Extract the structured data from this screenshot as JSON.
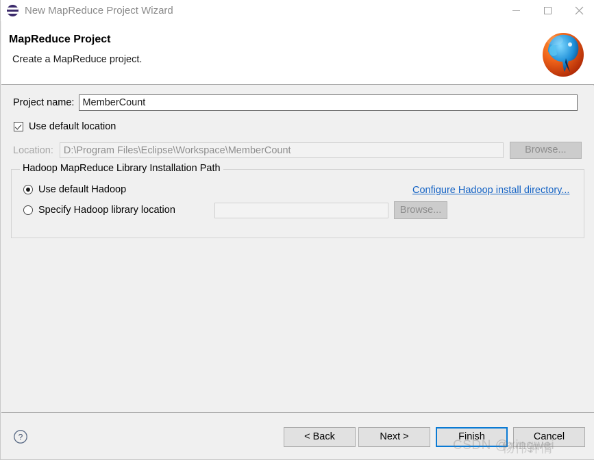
{
  "window": {
    "title": "New MapReduce Project Wizard",
    "icon": "eclipse-wizard-icon",
    "controls": {
      "minimize": "minimize-icon",
      "maximize": "maximize-icon",
      "close": "close-icon"
    }
  },
  "header": {
    "title": "MapReduce Project",
    "subtitle": "Create a MapReduce project.",
    "logo": "hadoop-elephant-logo"
  },
  "form": {
    "project_name_label": "Project name:",
    "project_name_value": "MemberCount",
    "project_name_placeholder": "",
    "use_default_location_label": "Use default location",
    "use_default_location_checked": true,
    "location_label": "Location:",
    "location_value": "D:\\Program Files\\Eclipse\\Workspace\\MemberCount",
    "location_browse_label": "Browse..."
  },
  "group": {
    "title": "Hadoop MapReduce Library Installation Path",
    "radio_default_label": "Use default Hadoop",
    "radio_default_selected": true,
    "radio_specify_label": "Specify Hadoop library location",
    "radio_specify_selected": false,
    "hadoop_lib_value": "",
    "hadoop_lib_placeholder": "",
    "configure_link_label": "Configure Hadoop install directory...",
    "lib_browse_label": "Browse..."
  },
  "footer": {
    "help_icon": "help-icon",
    "back_label": "< Back",
    "next_label": "Next >",
    "finish_label": "Finish",
    "cancel_label": "Cancel"
  },
  "watermark": {
    "text": "CSDN @xingwei",
    "text2": "杨伟钟情"
  },
  "colors": {
    "link": "#1362c4",
    "focus_border": "#0a7ad4",
    "dialog_bg": "#f0f0f0",
    "header_bg": "#ffffff"
  }
}
